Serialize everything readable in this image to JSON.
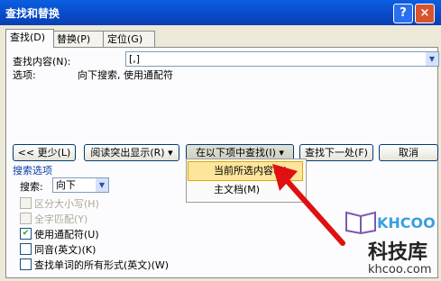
{
  "window": {
    "title": "查找和替换",
    "help": "?",
    "close": "×"
  },
  "tabs": [
    {
      "label": "查找(D)"
    },
    {
      "label": "替换(P)"
    },
    {
      "label": "定位(G)"
    }
  ],
  "find": {
    "label": "查找内容(N):",
    "value": "[,]",
    "options_label": "选项:",
    "options_value": "向下搜索, 使用通配符"
  },
  "buttons": {
    "less": "<< 更少(L)",
    "highlight": "阅读突出显示(R) ▾",
    "find_in": "在以下项中查找(I) ▾",
    "find_next": "查找下一处(F)",
    "cancel": "取消"
  },
  "menu": {
    "items": [
      "当前所选内容(S)",
      "主文档(M)"
    ]
  },
  "search_options": {
    "title": "搜索选项",
    "search_label": "搜索:",
    "search_value": "向下",
    "checkboxes": [
      {
        "label": "区分大小写(H)",
        "checked": false,
        "disabled": true
      },
      {
        "label": "全字匹配(Y)",
        "checked": false,
        "disabled": true
      },
      {
        "label": "使用通配符(U)",
        "checked": true,
        "disabled": false
      },
      {
        "label": "同音(英文)(K)",
        "checked": false,
        "disabled": false
      },
      {
        "label": "查找单词的所有形式(英文)(W)",
        "checked": false,
        "disabled": false
      }
    ]
  },
  "watermark": {
    "logo": "KHCOO",
    "name": "科技库",
    "url": "khcoo.com"
  },
  "colors": {
    "titlebar": "#0849c8",
    "dialog_bg": "#ece9d8",
    "highlight": "#fde59c",
    "arrow": "#e01010"
  }
}
